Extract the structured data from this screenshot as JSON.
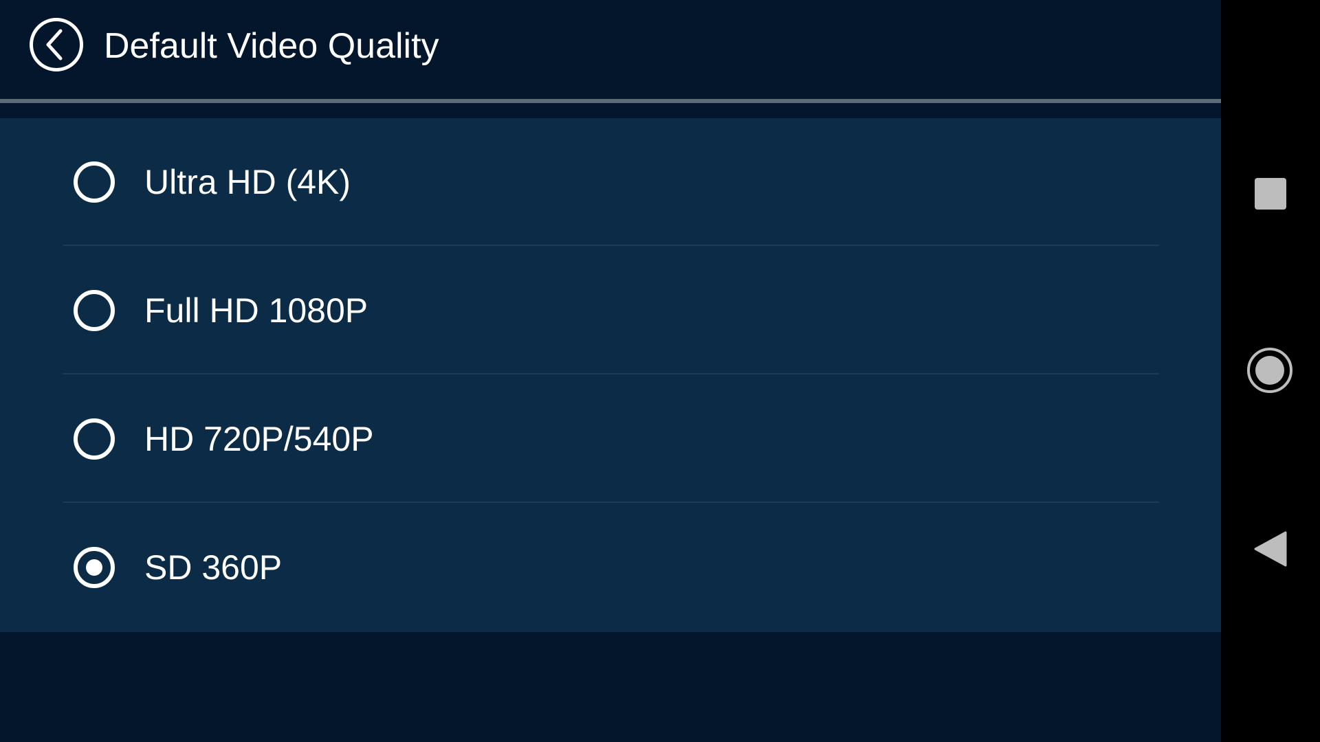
{
  "header": {
    "title": "Default Video Quality",
    "back_icon": "chevron-left-circle-icon"
  },
  "options": [
    {
      "label": "Ultra HD (4K)",
      "selected": false
    },
    {
      "label": "Full HD 1080P",
      "selected": false
    },
    {
      "label": "HD 720P/540P",
      "selected": false
    },
    {
      "label": "SD 360P",
      "selected": true
    }
  ],
  "nav_bar": {
    "recents_icon": "square-icon",
    "home_icon": "circle-icon",
    "back_icon": "triangle-left-icon"
  },
  "colors": {
    "background": "#03162b",
    "panel": "#0b2b47",
    "text": "#ffffff",
    "divider": "#1c3a55",
    "nav_bar": "#000000",
    "nav_icons": "#bdbdbd"
  }
}
